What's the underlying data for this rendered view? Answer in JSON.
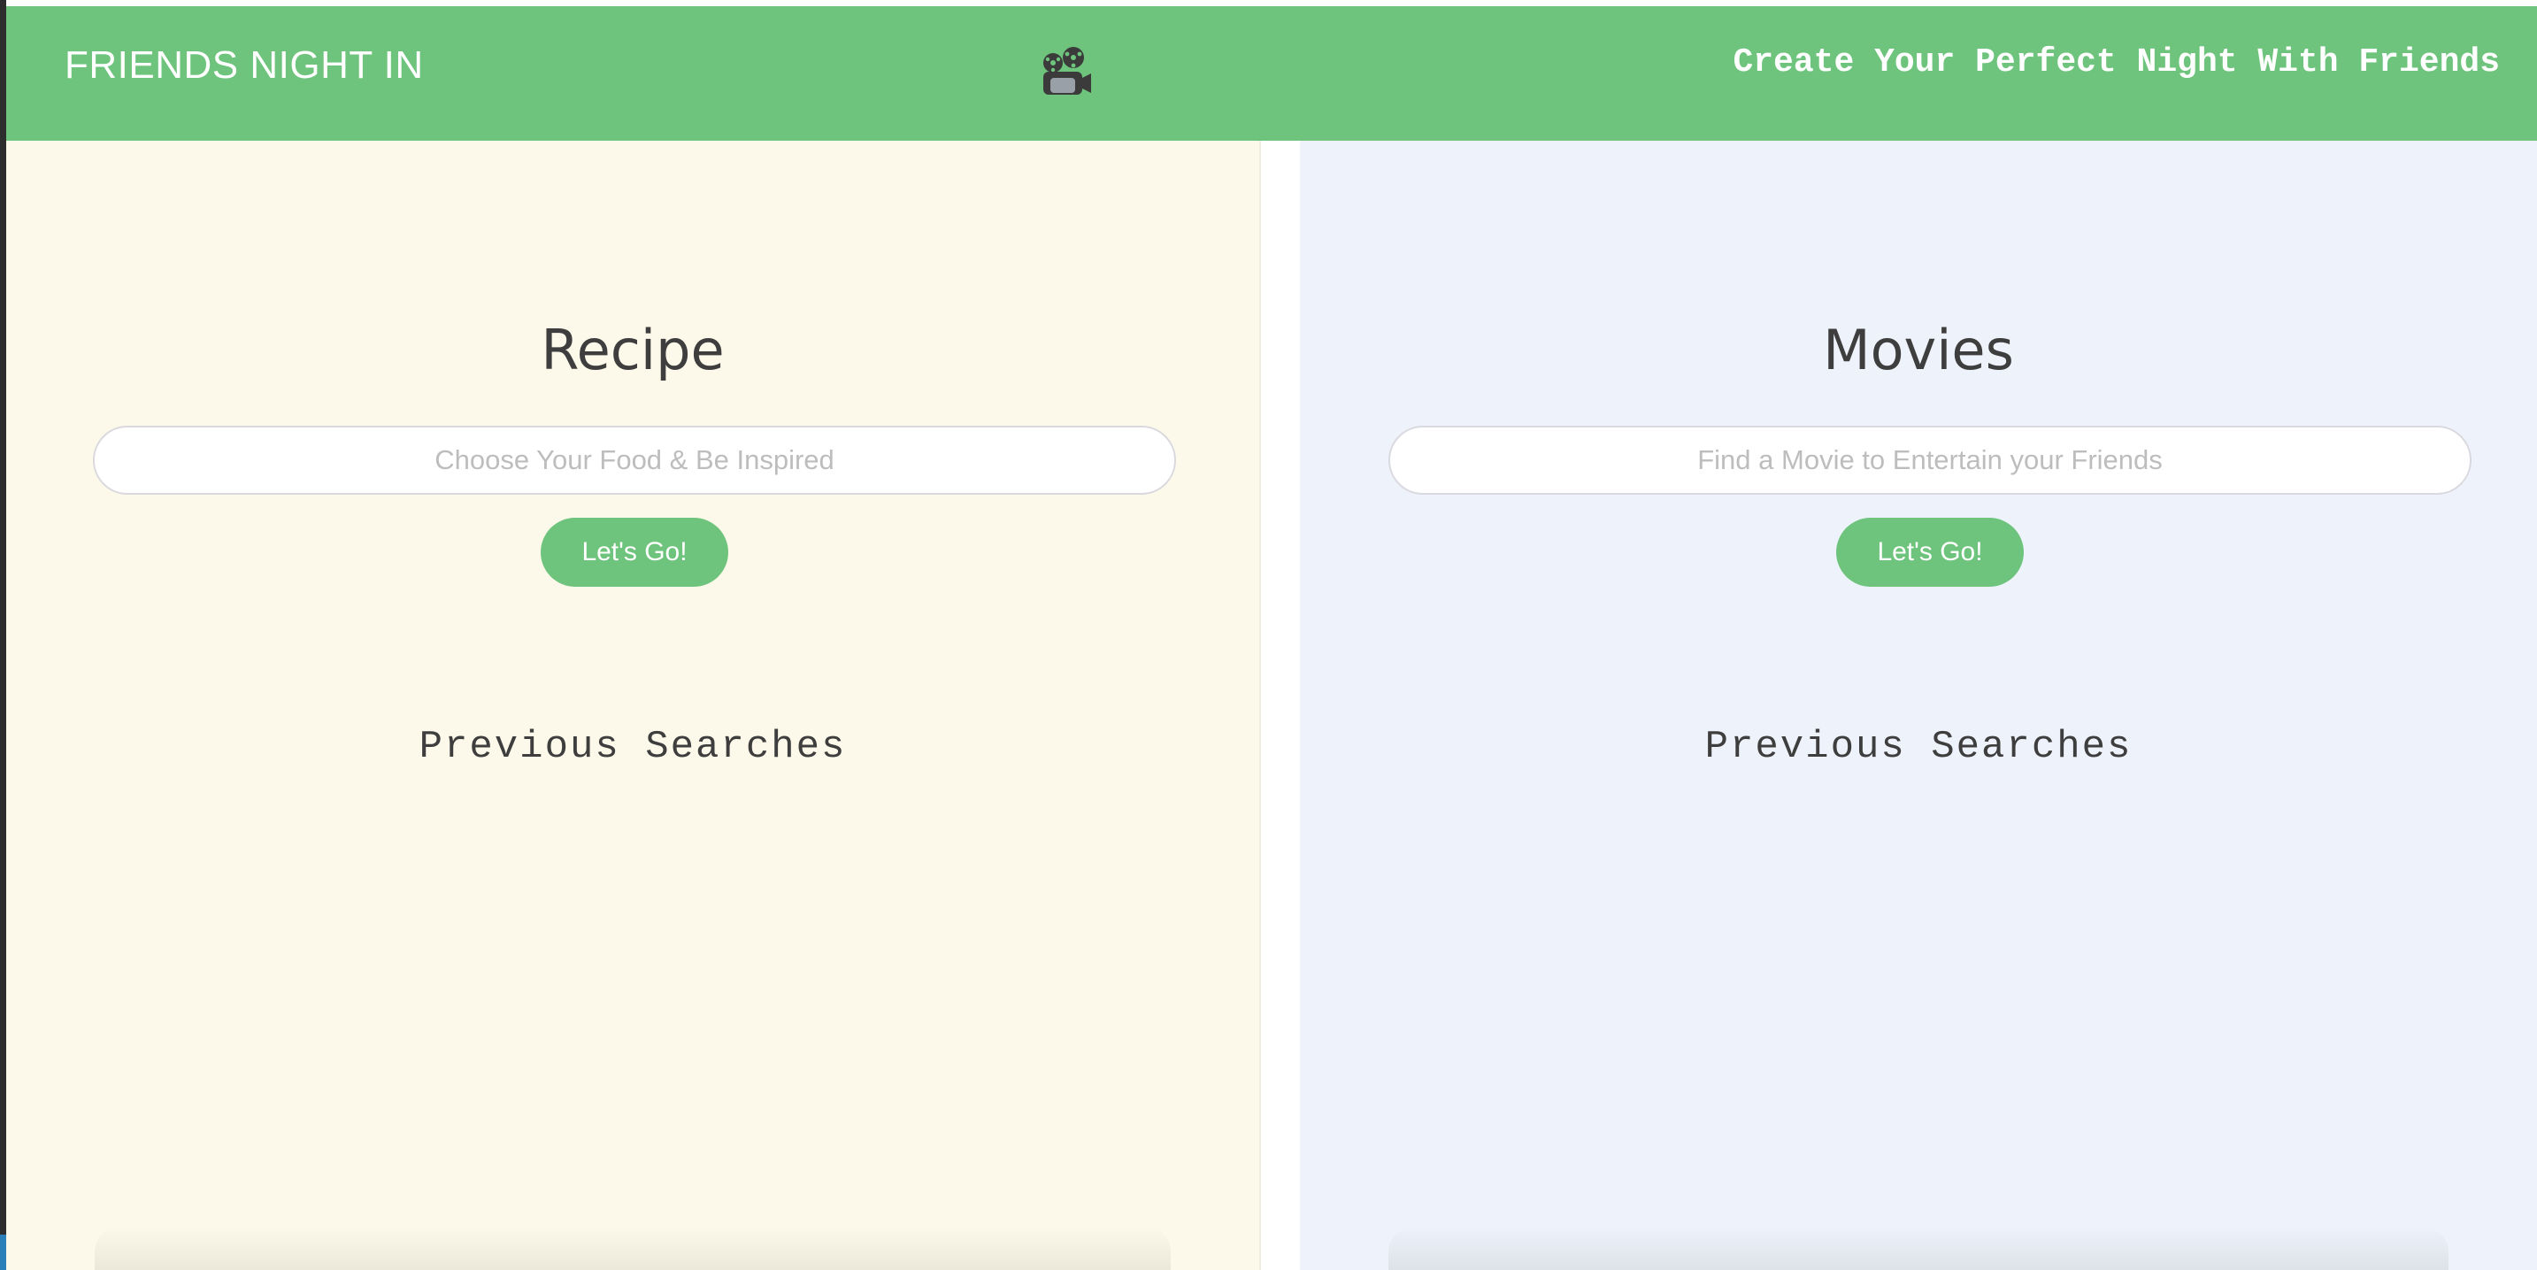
{
  "header": {
    "brand": "FRIENDS NIGHT IN",
    "logo_icon": "film-projector-icon",
    "tagline": "Create Your Perfect Night With Friends",
    "background_color": "#6ec47c"
  },
  "recipe_panel": {
    "title": "Recipe",
    "search_placeholder": "Choose Your Food & Be Inspired",
    "search_value": "",
    "button_label": "Let's Go!",
    "history_title": "Previous Searches",
    "history_items": [],
    "background_color": "#fdf9ea"
  },
  "movies_panel": {
    "title": "Movies",
    "search_placeholder": "Find a Movie to Entertain your Friends",
    "search_value": "",
    "button_label": "Let's Go!",
    "history_title": "Previous Searches",
    "history_items": [],
    "background_color": "#eef2fa"
  },
  "colors": {
    "accent": "#6ec47c",
    "text_dark": "#3e3e3e",
    "placeholder": "#bdbdbd"
  }
}
